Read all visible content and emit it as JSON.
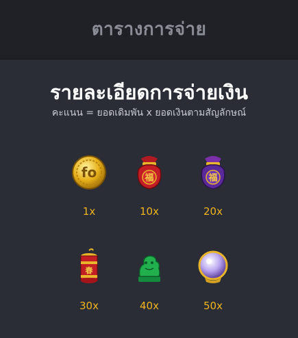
{
  "header": {
    "title": "ตารางการจ่าย"
  },
  "main": {
    "heading": "รายละเอียดการจ่ายเงิน",
    "formula": "คะแนน = ยอดเดิมพัน x ยอดเงินตามสัญลักษณ์"
  },
  "symbols": [
    {
      "icon": "gold-coin-icon",
      "multiplier": "1x"
    },
    {
      "icon": "red-fortune-bag-icon",
      "multiplier": "10x"
    },
    {
      "icon": "purple-fortune-bag-icon",
      "multiplier": "20x"
    },
    {
      "icon": "firecracker-icon",
      "multiplier": "30x"
    },
    {
      "icon": "jade-pixiu-icon",
      "multiplier": "40x"
    },
    {
      "icon": "crystal-orb-icon",
      "multiplier": "50x"
    }
  ],
  "colors": {
    "background": "#2a2d36",
    "topbar": "#1f2127",
    "multiplier": "#f2b51b"
  }
}
